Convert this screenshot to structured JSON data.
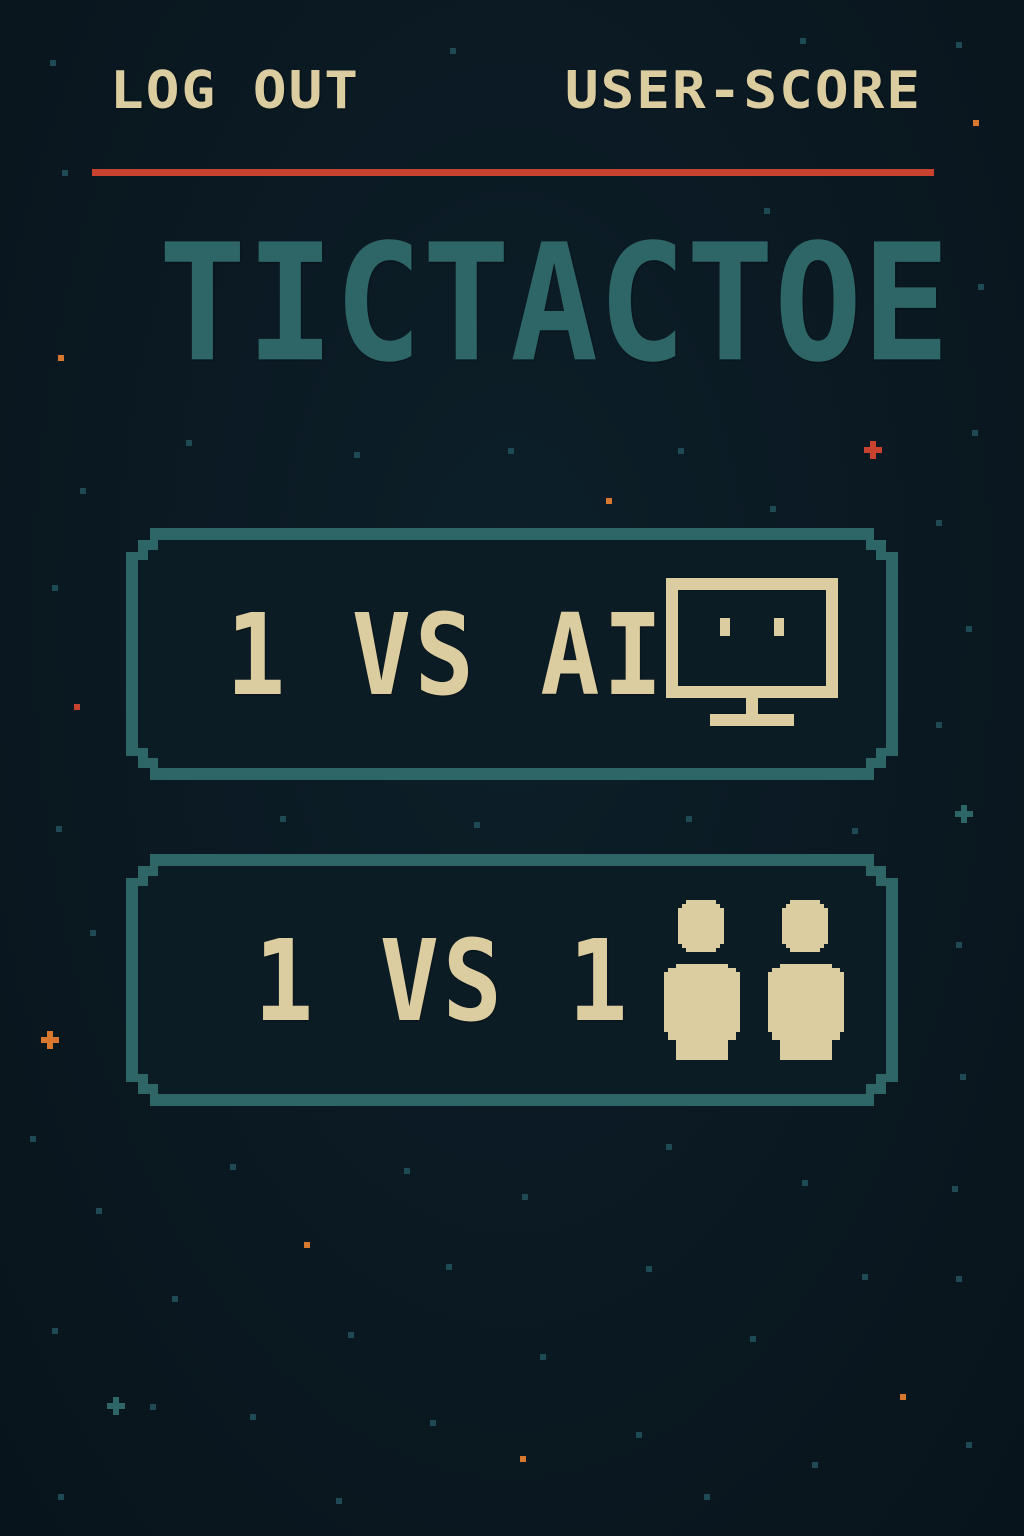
{
  "header": {
    "logout_label": "LOG OUT",
    "user_score_label": "USER-SCORE"
  },
  "title": "TICTACTOE",
  "modes": [
    {
      "label": "1 VS AI",
      "icon": "monitor-icon"
    },
    {
      "label": "1 VS 1",
      "icon": "two-players-icon"
    }
  ],
  "colors": {
    "background": "#0a1821",
    "accent_red": "#c8422f",
    "teal": "#2e6668",
    "text_cream": "#dccda0",
    "star_orange": "#d8782e"
  }
}
